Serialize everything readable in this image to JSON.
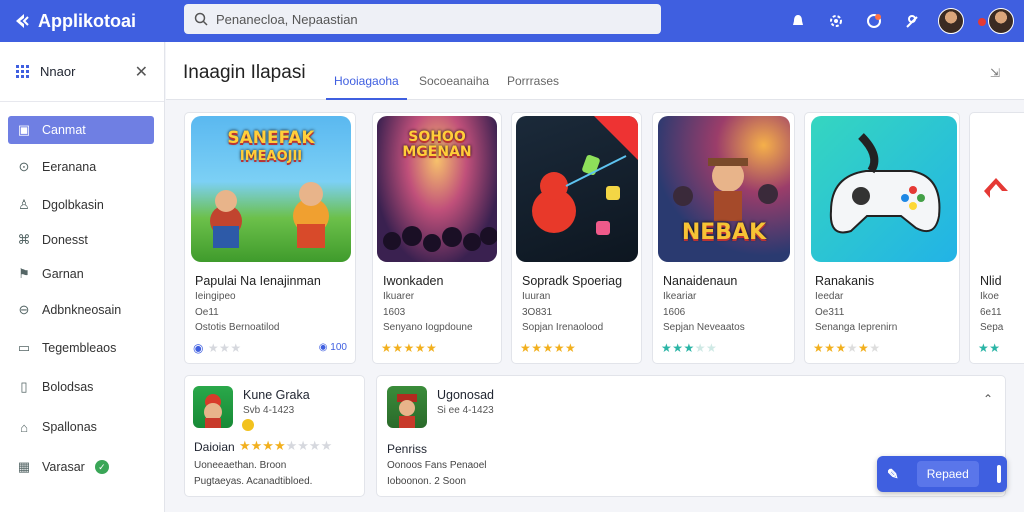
{
  "app": {
    "name": "Applikotoai"
  },
  "search": {
    "value": "Penanecloa, Nepaastian",
    "placeholder": "Penanecloa, Nepaastian"
  },
  "sidebar": {
    "header_label": "Nnaor",
    "items": [
      {
        "label": "Canmat",
        "icon": "grid-icon",
        "active": true
      },
      {
        "label": "Eeranana",
        "icon": "compass-icon"
      },
      {
        "label": "Dgolbkasin",
        "icon": "person-icon"
      },
      {
        "label": "Donesst",
        "icon": "gamepad-icon"
      },
      {
        "label": "Garnan",
        "icon": "flag-icon"
      },
      {
        "label": "Adbnkneosain",
        "icon": "shield-icon"
      },
      {
        "label": "Tegembleaos",
        "icon": "document-icon"
      },
      {
        "label": "Bolodsas",
        "icon": "book-icon"
      },
      {
        "label": "Spallonas",
        "icon": "puzzle-icon"
      },
      {
        "label": "Varasar",
        "icon": "store-icon",
        "badge": "✓"
      }
    ]
  },
  "main": {
    "title": "Inaagin Ilapasi",
    "tabs": [
      {
        "label": "Hooiagaoha",
        "active": true
      },
      {
        "label": "Socoeanaiha"
      },
      {
        "label": "Porrrases"
      }
    ],
    "header_action": "⁷⁄₆"
  },
  "cards": [
    {
      "title": "Papulai Na Ienajinman",
      "line1": "Ieingipeo",
      "line2": "Oe11",
      "line3": "Ostotis Bernoatilod",
      "stars": "★★★★★",
      "rating_filled": 0,
      "pill": "◉ 100",
      "art_title": "SANEFAK\nIMEAOJII"
    },
    {
      "title": "Iwonkaden",
      "line1": "Ikuarer",
      "line2": "1603",
      "line3": "Senyano Iogpdoune",
      "stars": "★★★★★",
      "rating_filled": 5,
      "pill": "",
      "art_title": "SOHOO\nMGENAN"
    },
    {
      "title": "Sopradk Spoeriag",
      "line1": "Iuuran",
      "line2": "3O831",
      "line3": "Sopjan Irenaolood",
      "stars": "★★★★★",
      "rating_filled": 5,
      "pill": "",
      "art_title": ""
    },
    {
      "title": "Nanaidenaun",
      "line1": "Ikeariar",
      "line2": "1606",
      "line3": "Sepjan Neveaatos",
      "stars": "★★★★★",
      "rating_filled": 3,
      "pill": "",
      "art_title": "NEBAK"
    },
    {
      "title": "Ranakanis",
      "line1": "Ieedar",
      "line2": "Oe311",
      "line3": "Senanga Ieprenirn",
      "stars": "★★★★★",
      "rating_filled": 3,
      "pill": "",
      "art_title": ""
    },
    {
      "title": "Nlid",
      "line1": "Ikoe",
      "line2": "6e11",
      "line3": "Sepa",
      "stars": "★★★",
      "rating_filled": 2,
      "pill": "",
      "art_title": ""
    }
  ],
  "bottom": {
    "left": {
      "title": "Kune Graka",
      "sub": "Svb 4-1423",
      "label": "Daioian",
      "stars": "★★★★★★★★",
      "rating_filled": 4,
      "line1": "Uoneeaethan. Broon",
      "line2": "Pugtaeyas. Acanadtibloed."
    },
    "right": {
      "title": "Ugonosad",
      "sub": "Si ee 4-1423",
      "label": "Penriss",
      "line1": "Oonoos Fans Penaoel",
      "line2": "Ioboonon. 2 Soon"
    },
    "fab_label": "Repaed"
  },
  "colors": {
    "brand": "#3f5fe0",
    "active_item": "#6f7fe3",
    "star": "#f2b01e"
  }
}
